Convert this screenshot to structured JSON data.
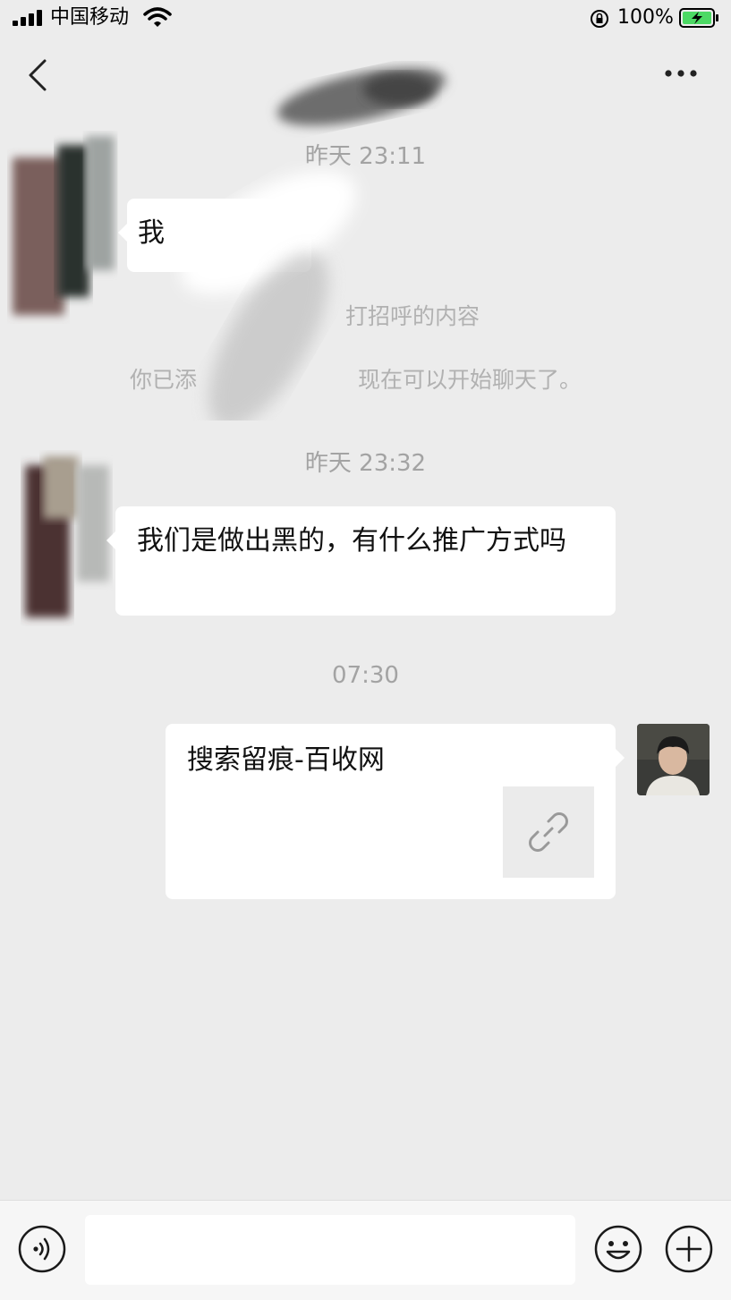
{
  "status_bar": {
    "carrier": "中国移动",
    "battery_percent": "100%",
    "battery_icon": "battery-charging-icon",
    "wifi_icon": "wifi-icon",
    "signal_icon": "signal-icon",
    "orientation_lock_icon": "orientation-lock-icon"
  },
  "nav": {
    "back_icon": "chevron-left-icon",
    "more_icon": "more-dots-icon"
  },
  "messages": {
    "timestamp_1": "昨天 23:11",
    "bubble_1_visible_text": "我",
    "greeting_visible_text": "打招呼的内容",
    "added_prefix": "你已添",
    "added_suffix": "现在可以开始聊天了。",
    "timestamp_2": "昨天 23:32",
    "bubble_2_text": "我们是做出黑的，有什么推广方式吗",
    "timestamp_3": "07:30",
    "link_card_title": "搜索留痕-百收网",
    "link_icon": "link-icon"
  },
  "input_bar": {
    "voice_icon": "voice-icon",
    "emoji_icon": "emoji-icon",
    "plus_icon": "plus-circle-icon",
    "placeholder": ""
  },
  "colors": {
    "background": "#ececec",
    "bubble": "#ffffff",
    "timestamp": "#a3a3a3",
    "input_bar": "#f6f6f6"
  }
}
